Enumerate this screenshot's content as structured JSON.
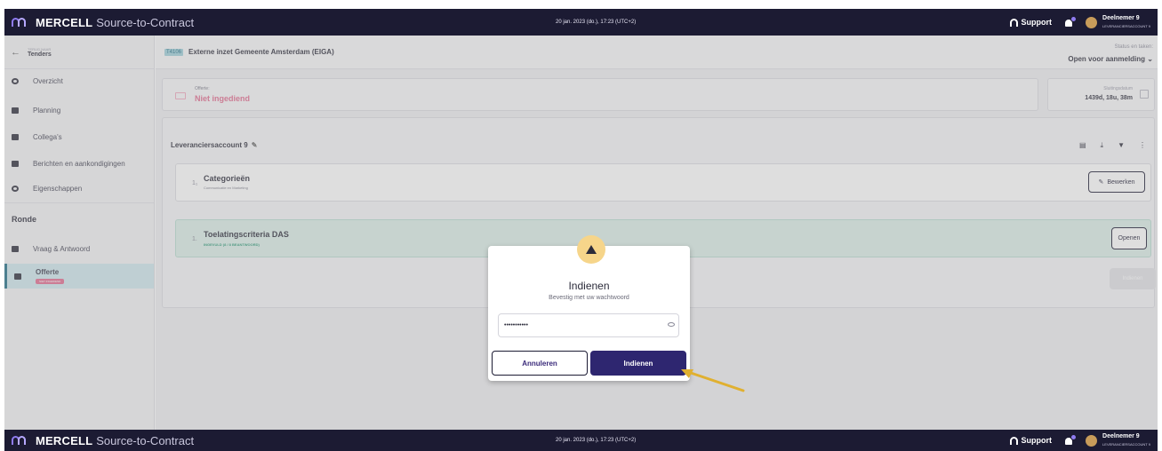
{
  "topbar": {
    "brand": "MERCELL",
    "product": "Source-to-Contract",
    "datetime": "20 jan. 2023 (do.), 17:23 (UTC+2)",
    "support": "Support",
    "user_name": "Deelnemer 9",
    "user_sub": "LEVERANCIERSACCOUNT 9"
  },
  "sidebar": {
    "back_small": "TERUG NAAR",
    "back_title": "Tenders",
    "items": [
      {
        "label": "Overzicht",
        "icon": "gauge-icon"
      },
      {
        "label": "Planning",
        "icon": "calendar-icon"
      },
      {
        "label": "Collega's",
        "icon": "users-icon"
      },
      {
        "label": "Berichten en aankondigingen",
        "icon": "message-icon"
      },
      {
        "label": "Eigenschappen",
        "icon": "gear-icon"
      }
    ],
    "round_title": "Ronde",
    "round_items": [
      {
        "label": "Vraag & Antwoord",
        "icon": "chat-icon"
      },
      {
        "label": "Offerte",
        "icon": "mail-icon",
        "badge": "NIET INGEDIEND"
      }
    ]
  },
  "tender": {
    "code": "T4106",
    "title": "Externe inzet Gemeente Amsterdam (EIGA)",
    "status_label": "Status en taken:",
    "status_value": "Open voor aanmelding"
  },
  "offer": {
    "label": "Offerte:",
    "value": "Niet ingediend",
    "closing_label": "Sluitingsdatum",
    "closing_value": "1439d, 18u, 38m"
  },
  "account": {
    "title": "Leveranciersaccount 9"
  },
  "categories": {
    "num": "1₁",
    "title": "Categorieën",
    "sub": "Communicatie en Marketing",
    "edit_label": "Bewerken"
  },
  "admission": {
    "num": "1.",
    "title": "Toelatingscriteria DAS",
    "sub": "INGEVULD (8 / 8 BEANTWOORD)",
    "open_label": "Openen"
  },
  "submit_bg_label": "Indienen",
  "modal": {
    "title": "Indienen",
    "subtitle": "Bevestig met uw wachtwoord",
    "password_value": "•••••••••••",
    "cancel_label": "Annuleren",
    "confirm_label": "Indienen"
  },
  "colors": {
    "topbar": "#1c1b33",
    "accent": "#2e2670",
    "warning": "#f6d58a",
    "pink": "#e36b8f",
    "green_row": "#dcefe9",
    "arrow": "#e0b030"
  }
}
